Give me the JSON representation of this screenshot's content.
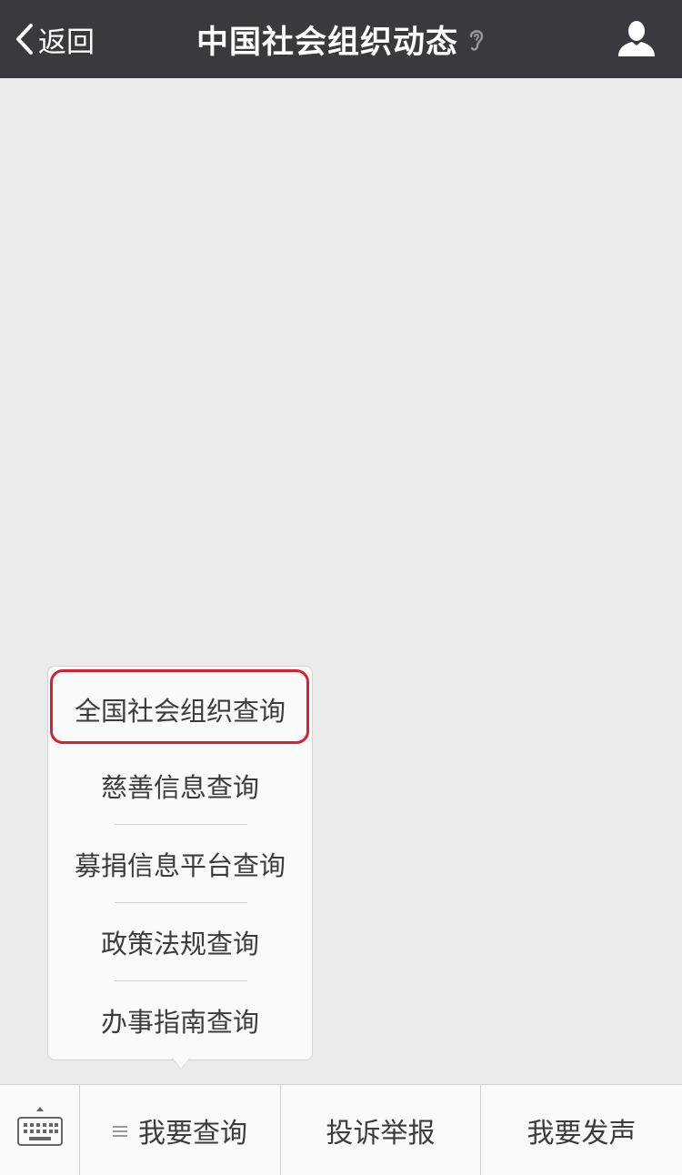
{
  "navbar": {
    "back_label": "返回",
    "title": "中国社会组织动态",
    "background": "#393a3e"
  },
  "popup_menu": {
    "items": [
      {
        "label": "全国社会组织查询",
        "highlighted": true
      },
      {
        "label": "慈善信息查询"
      },
      {
        "label": "募捐信息平台查询"
      },
      {
        "label": "政策法规查询"
      },
      {
        "label": "办事指南查询"
      }
    ]
  },
  "bottom_bar": {
    "tabs": [
      {
        "label": "我要查询",
        "has_menu_icon": true
      },
      {
        "label": "投诉举报"
      },
      {
        "label": "我要发声"
      }
    ]
  },
  "icons": {
    "back": "chevron-left-icon",
    "ear": "ear-icon",
    "profile": "user-icon",
    "keyboard": "keyboard-icon",
    "submenu": "menu-lines-icon"
  },
  "colors": {
    "highlight": "#d8202e",
    "background": "#ebebeb"
  }
}
